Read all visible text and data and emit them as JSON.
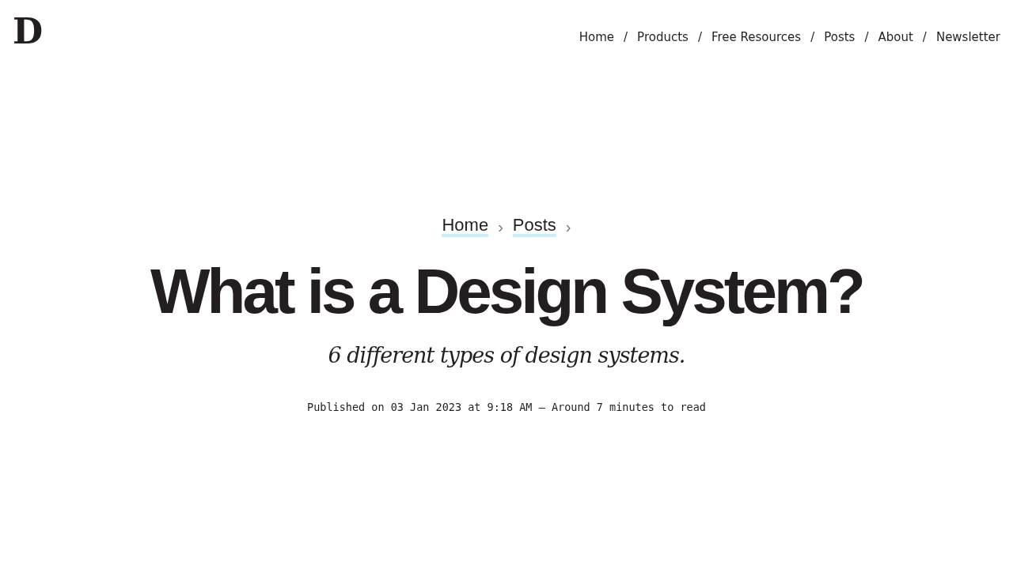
{
  "logo": {
    "text": "D"
  },
  "nav": {
    "separator": "/",
    "items": [
      "Home",
      "Products",
      "Free Resources",
      "Posts",
      "About",
      "Newsletter"
    ]
  },
  "breadcrumb": {
    "separator": "›",
    "items": [
      "Home",
      "Posts"
    ]
  },
  "title": "What is a Design System?",
  "subtitle": "6 different types of design systems.",
  "meta": "Published on 03 Jan 2023 at 9:18 AM — Around 7 minutes to read"
}
